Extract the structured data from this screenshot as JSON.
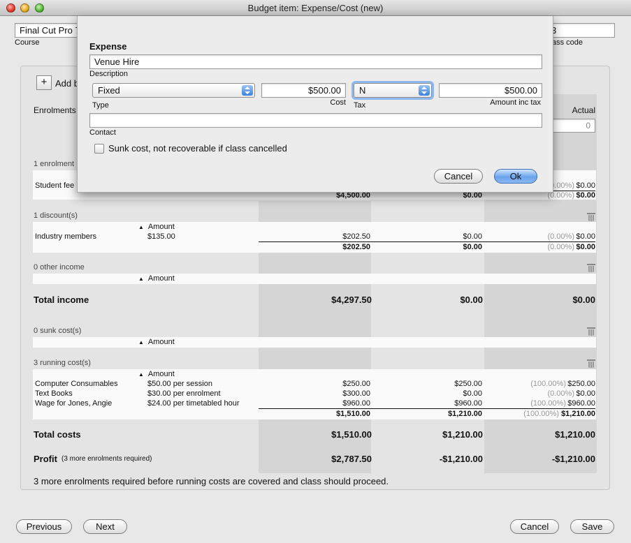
{
  "window": {
    "title": "Budget item: Expense/Cost (new)"
  },
  "background_form": {
    "course_value": "Final Cut Pro 7",
    "course_label": "Course",
    "class_code_value": "3",
    "class_code_label": "ass code",
    "add_label": "Add b",
    "plus": "+"
  },
  "columns": {
    "enrolments": "Enrolments",
    "actual": "Actual",
    "actual_input": "0"
  },
  "income": {
    "enrolment_section": "1 enrolment",
    "student_fee": {
      "label": "Student fee",
      "actual_pct": "0.00%)",
      "actual": "$0.00"
    },
    "subtotal": {
      "budget": "$4,500.00",
      "forecast": "$0.00",
      "actual_pct": "(0.00%)",
      "actual": "$0.00"
    }
  },
  "discounts": {
    "section": "1 discount(s)",
    "amount_header": "Amount",
    "rows": [
      {
        "name": "Industry members",
        "amount": "$135.00",
        "budget": "$202.50",
        "forecast": "$0.00",
        "actual_pct": "(0.00%)",
        "actual": "$0.00"
      }
    ],
    "subtotal": {
      "budget": "$202.50",
      "forecast": "$0.00",
      "actual_pct": "(0.00%)",
      "actual": "$0.00"
    }
  },
  "other_income": {
    "section": "0 other income",
    "amount_header": "Amount"
  },
  "total_income": {
    "label": "Total income",
    "budget": "$4,297.50",
    "forecast": "$0.00",
    "actual": "$0.00"
  },
  "sunk_costs": {
    "section": "0 sunk cost(s)",
    "amount_header": "Amount"
  },
  "running_costs": {
    "section": "3 running cost(s)",
    "amount_header": "Amount",
    "rows": [
      {
        "name": "Computer Consumables",
        "amount": "$50.00 per session",
        "budget": "$250.00",
        "forecast": "$250.00",
        "actual_pct": "(100.00%)",
        "actual": "$250.00"
      },
      {
        "name": "Text Books",
        "amount": "$30.00 per enrolment",
        "budget": "$300.00",
        "forecast": "$0.00",
        "actual_pct": "(0.00%)",
        "actual": "$0.00"
      },
      {
        "name": "Wage for Jones, Angie",
        "amount": "$24.00 per timetabled hour",
        "budget": "$960.00",
        "forecast": "$960.00",
        "actual_pct": "(100.00%)",
        "actual": "$960.00"
      }
    ],
    "subtotal": {
      "budget": "$1,510.00",
      "forecast": "$1,210.00",
      "actual_pct": "(100.00%)",
      "actual": "$1,210.00"
    }
  },
  "total_costs": {
    "label": "Total costs",
    "budget": "$1,510.00",
    "forecast": "$1,210.00",
    "actual": "$1,210.00"
  },
  "profit": {
    "label": "Profit",
    "note": "(3 more enrolments required)",
    "budget": "$2,787.50",
    "forecast": "-$1,210.00",
    "actual": "-$1,210.00"
  },
  "footer_message": "3 more enrolments required before running costs are covered and class should proceed.",
  "bottom_buttons": {
    "previous": "Previous",
    "next": "Next",
    "cancel": "Cancel",
    "save": "Save"
  },
  "dialog": {
    "heading": "Expense",
    "description_value": "Venue Hire",
    "description_label": "Description",
    "type_value": "Fixed",
    "type_label": "Type",
    "cost_value": "$500.00",
    "cost_label": "Cost",
    "tax_value": "N",
    "tax_label": "Tax",
    "amount_inc_tax_value": "$500.00",
    "amount_inc_tax_label": "Amount inc tax",
    "contact_value": "",
    "contact_label": "Contact",
    "sunk_cost_label": "Sunk cost, not recoverable if class cancelled",
    "sunk_cost_checked": false,
    "cancel": "Cancel",
    "ok": "Ok",
    "accent_color": "#3d80dc"
  }
}
